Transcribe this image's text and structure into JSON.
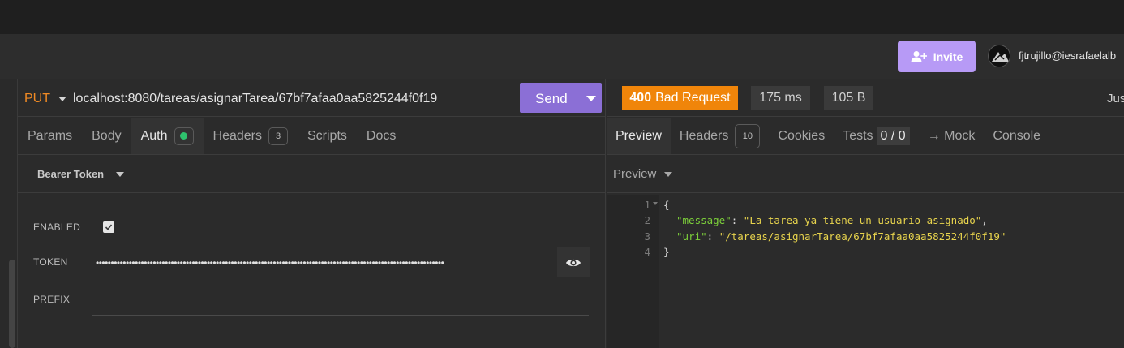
{
  "topbar": {
    "invite_label": "Invite",
    "user_email": "fjtrujillo@iesrafaelalb"
  },
  "request": {
    "method": "PUT",
    "url": "localhost:8080/tareas/asignarTarea/67bf7afaa0aa5825244f0f19",
    "send_label": "Send",
    "tabs": [
      {
        "label": "Params"
      },
      {
        "label": "Body"
      },
      {
        "label": "Auth",
        "status": "enabled"
      },
      {
        "label": "Headers",
        "count": "3"
      },
      {
        "label": "Scripts"
      },
      {
        "label": "Docs"
      }
    ],
    "active_tab": "Auth",
    "auth": {
      "type_label": "Bearer Token",
      "enabled_label": "ENABLED",
      "enabled": true,
      "token_label": "TOKEN",
      "token_masked": "••••••••••••••••••••••••••••••••••••••••••••••••••••••••••••••••••••••••••••••••••••••••••••••••••••••••••••••••••••",
      "prefix_label": "PREFIX",
      "prefix_value": ""
    }
  },
  "response": {
    "status_code": "400",
    "status_text": "Bad Request",
    "time": "175 ms",
    "size": "105 B",
    "timestamp_partial": "Jus",
    "tabs": [
      {
        "label": "Preview"
      },
      {
        "label": "Headers",
        "count": "10"
      },
      {
        "label": "Cookies"
      },
      {
        "label": "Tests",
        "count": "0 / 0"
      },
      {
        "label": "→ Mock"
      },
      {
        "label": "Console"
      }
    ],
    "active_tab": "Preview",
    "preview_mode_label": "Preview",
    "body_lines": [
      {
        "num": "1",
        "open": "{"
      },
      {
        "num": "2",
        "key": "\"message\"",
        "sep": ": ",
        "value": "\"La tarea ya tiene un usuario asignado\"",
        "end": ","
      },
      {
        "num": "3",
        "key": "\"uri\"",
        "sep": ": ",
        "value": "\"/tareas/asignarTarea/67bf7afaa0aa5825244f0f19\"",
        "end": ""
      },
      {
        "num": "4",
        "close": "}"
      }
    ]
  },
  "colors": {
    "accent_purple": "#8b6fd6",
    "invite_purple": "#b79af6",
    "method_orange": "#f08a24",
    "status_orange": "#f0850a",
    "json_key_green": "#7ccf3a",
    "json_string_yellow": "#e8d44d",
    "auth_dot_green": "#2ec26d"
  },
  "icons": {
    "invite": "user-plus-icon",
    "visibility": "eye-icon",
    "checkbox": "check-icon"
  }
}
